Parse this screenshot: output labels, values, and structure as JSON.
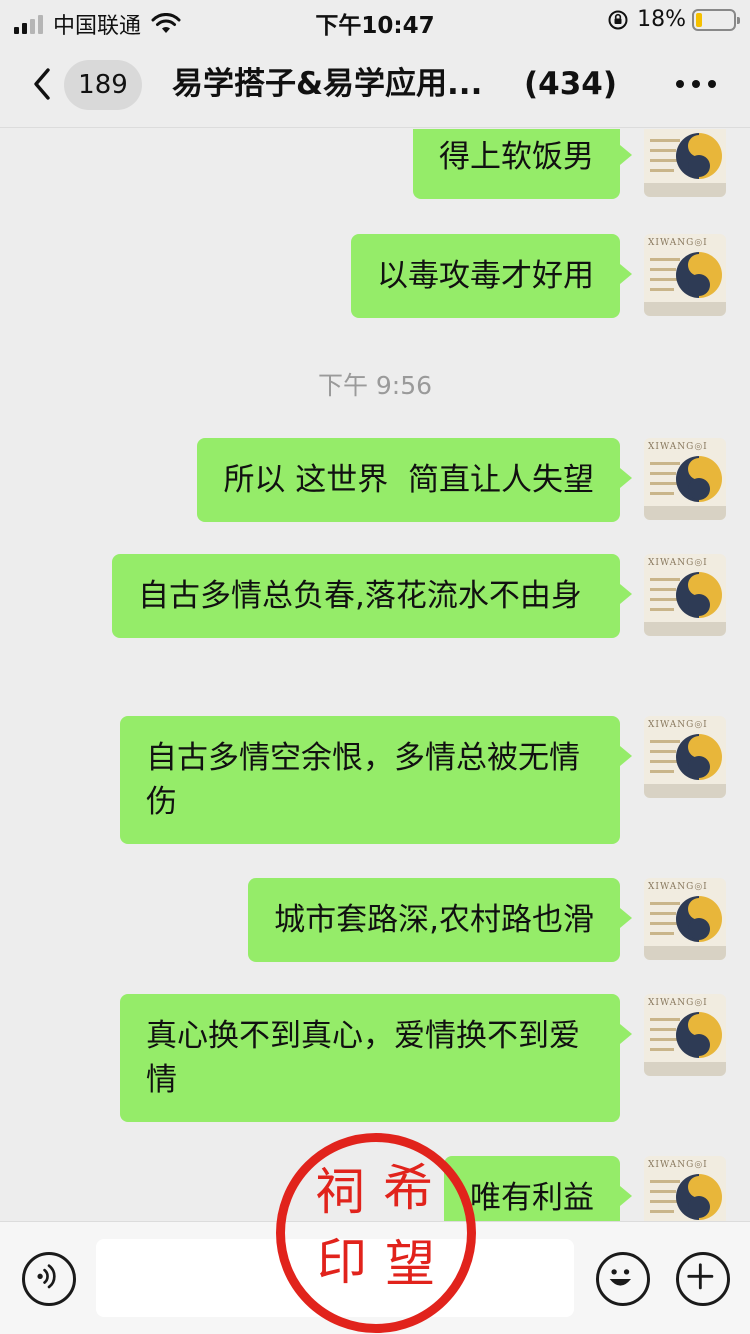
{
  "status_bar": {
    "carrier": "中国联通",
    "time": "下午10:47",
    "battery": "18%",
    "battery_level": 0.18
  },
  "header": {
    "unread_count": "189",
    "title": "易学搭子&易学应用...",
    "member_count": "(434)"
  },
  "avatar": {
    "brand_text": "XIWANG◎I",
    "icon": "yin-yang-avatar"
  },
  "messages": [
    {
      "text": "得上软饭男"
    },
    {
      "text": "以毒攻毒才好用"
    },
    {
      "text": "所以 这世界  简直让人失望"
    },
    {
      "text": "自古多情总负春,落花流水不由身"
    },
    {
      "text": "自古多情空余恨，多情总被无情伤"
    },
    {
      "text": "城市套路深,农村路也滑"
    },
    {
      "text": "真心换不到真心，爱情换不到爱情"
    },
    {
      "text": "唯有利益"
    }
  ],
  "timestamp": "下午 9:56",
  "stamp": {
    "chars": [
      "祠",
      "希",
      "印",
      "望"
    ]
  },
  "input_bar": {
    "voice_icon": "voice-icon",
    "emoji_icon": "emoji-icon",
    "plus_icon": "plus-icon",
    "input_value": ""
  },
  "colors": {
    "bubble": "#95ec69",
    "background": "#ededed",
    "stamp": "#e1231c"
  }
}
